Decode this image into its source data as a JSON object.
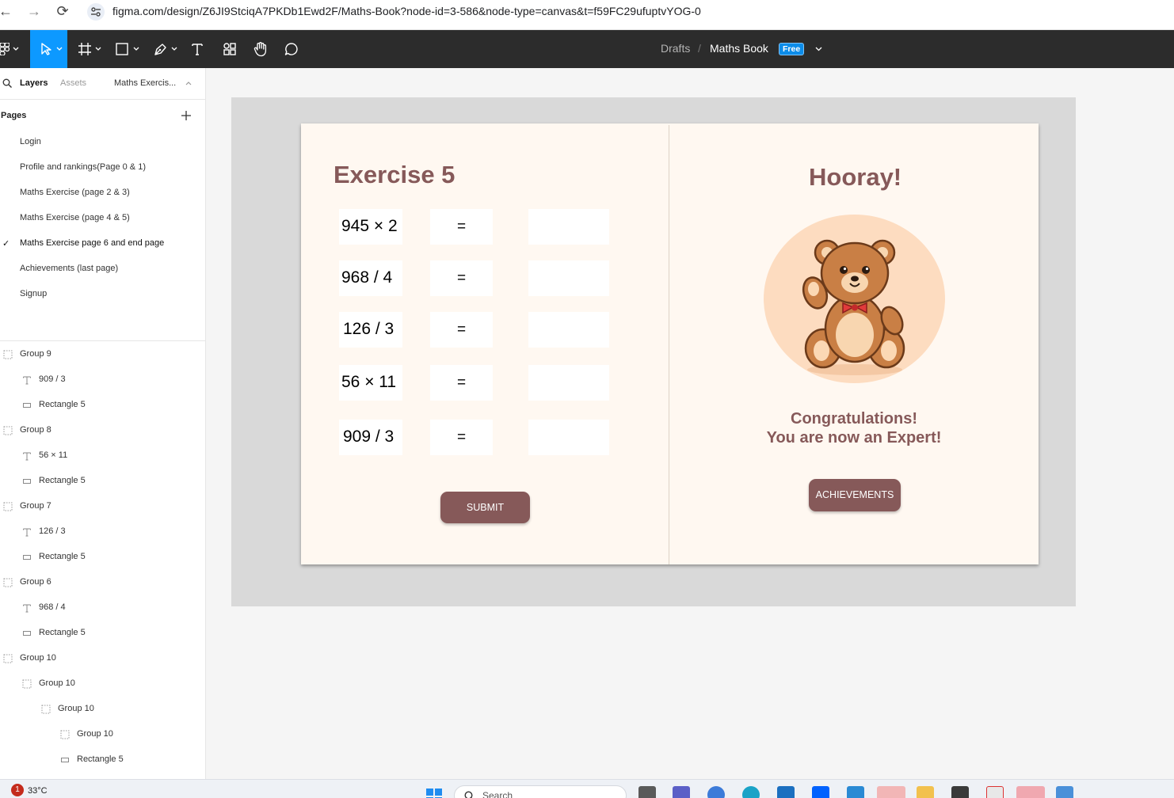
{
  "browser": {
    "url": "figma.com/design/Z6JI9StciqA7PKDb1Ewd2F/Maths-Book?node-id=3-586&node-type=canvas&t=f59FC29ufuptvYOG-0"
  },
  "toolbar": {
    "breadcrumb_drafts": "Drafts",
    "breadcrumb_sep": "/",
    "file_name": "Maths Book",
    "plan_badge": "Free"
  },
  "left_panel": {
    "tab_layers": "Layers",
    "tab_assets": "Assets",
    "page_selector": "Maths Exercis...",
    "pages_header": "Pages",
    "current_check": "✓",
    "pages": [
      "Login",
      "Profile and rankings(Page 0 & 1)",
      "Maths Exercise (page 2 & 3)",
      "Maths Exercise (page 4 & 5)",
      "Maths Exercise page 6 and end page",
      "Achievements (last page)",
      "Signup"
    ],
    "current_page_index": 4,
    "layers": [
      {
        "name": "Group 9",
        "type": "group",
        "indent": 0
      },
      {
        "name": "909 / 3",
        "type": "text",
        "indent": 1
      },
      {
        "name": "Rectangle 5",
        "type": "rectangle",
        "indent": 1
      },
      {
        "name": "Group 8",
        "type": "group",
        "indent": 0
      },
      {
        "name": "56 × 11",
        "type": "text",
        "indent": 1
      },
      {
        "name": "Rectangle 5",
        "type": "rectangle",
        "indent": 1
      },
      {
        "name": "Group 7",
        "type": "group",
        "indent": 0
      },
      {
        "name": "126 / 3",
        "type": "text",
        "indent": 1
      },
      {
        "name": "Rectangle 5",
        "type": "rectangle",
        "indent": 1
      },
      {
        "name": "Group 6",
        "type": "group",
        "indent": 0
      },
      {
        "name": "968 / 4",
        "type": "text",
        "indent": 1
      },
      {
        "name": "Rectangle 5",
        "type": "rectangle",
        "indent": 1
      },
      {
        "name": "Group 10",
        "type": "group",
        "indent": 0
      },
      {
        "name": "Group 10",
        "type": "group",
        "indent": 1
      },
      {
        "name": "Group 10",
        "type": "group",
        "indent": 2
      },
      {
        "name": "Group 10",
        "type": "group",
        "indent": 3
      },
      {
        "name": "Rectangle 5",
        "type": "rectangle",
        "indent": 3
      }
    ]
  },
  "canvas": {
    "exercise_title": "Exercise 5",
    "questions": [
      {
        "expr": "945 × 2",
        "eq": "=",
        "answer": ""
      },
      {
        "expr": "968 / 4",
        "eq": "=",
        "answer": ""
      },
      {
        "expr": "126 / 3",
        "eq": "=",
        "answer": ""
      },
      {
        "expr": "56 × 11",
        "eq": "=",
        "answer": ""
      },
      {
        "expr": "909 / 3",
        "eq": "=",
        "answer": ""
      }
    ],
    "submit_label": "SUBMIT",
    "hooray": "Hooray!",
    "congrats_line1": "Congratulations!",
    "congrats_line2": "You are now an Expert!",
    "achievements_label": "ACHIEVEMENTS"
  },
  "taskbar": {
    "notification_count": "1",
    "temperature": "33°C",
    "search_label": "Search"
  },
  "colors": {
    "accent": "#865959",
    "book_bg": "#fff8f1",
    "figma_blue": "#0d99ff",
    "toolbar_bg": "#2c2c2c"
  }
}
